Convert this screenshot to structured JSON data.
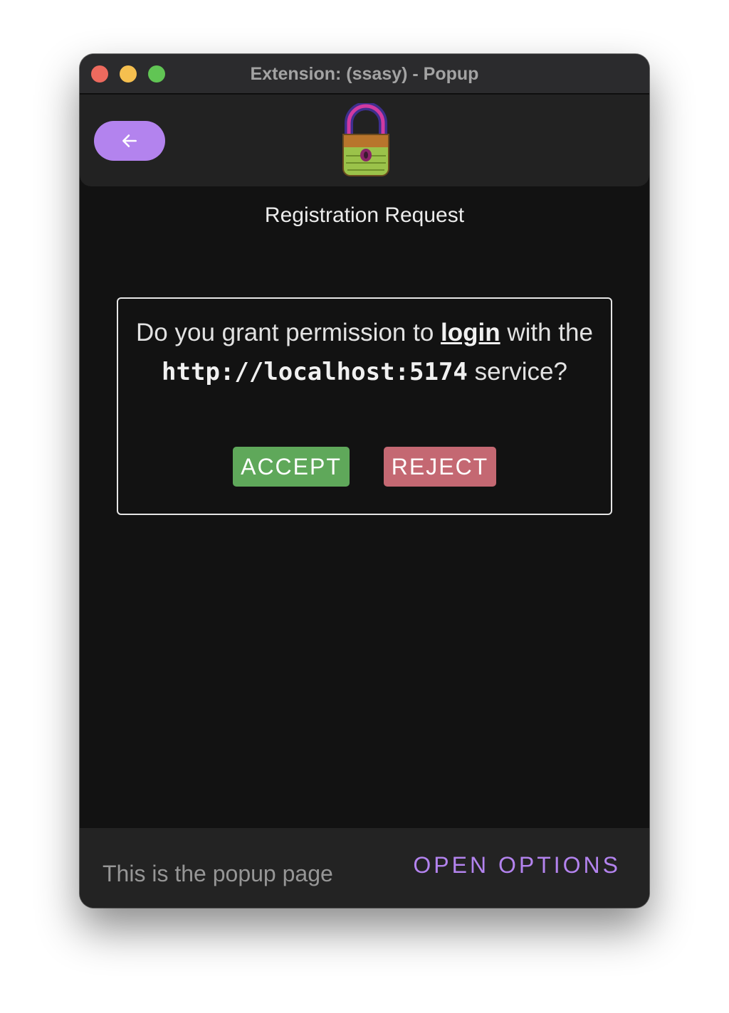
{
  "window": {
    "title": "Extension: (ssasy) - Popup"
  },
  "header": {
    "back_icon": "arrow-left-icon",
    "logo_icon": "padlock-logo-icon"
  },
  "page": {
    "heading": "Registration Request"
  },
  "prompt": {
    "text_before": "Do you grant permission to ",
    "action": "login",
    "text_middle": " with the ",
    "service_url": "http://localhost:5174",
    "text_after": " service?",
    "accept_label": "ACCEPT",
    "reject_label": "REJECT"
  },
  "footer": {
    "text": "This is the popup page",
    "options_label": "OPEN OPTIONS"
  },
  "colors": {
    "accent": "#b383ee",
    "accept": "#5fa85a",
    "reject": "#c46872",
    "background": "#121212"
  }
}
